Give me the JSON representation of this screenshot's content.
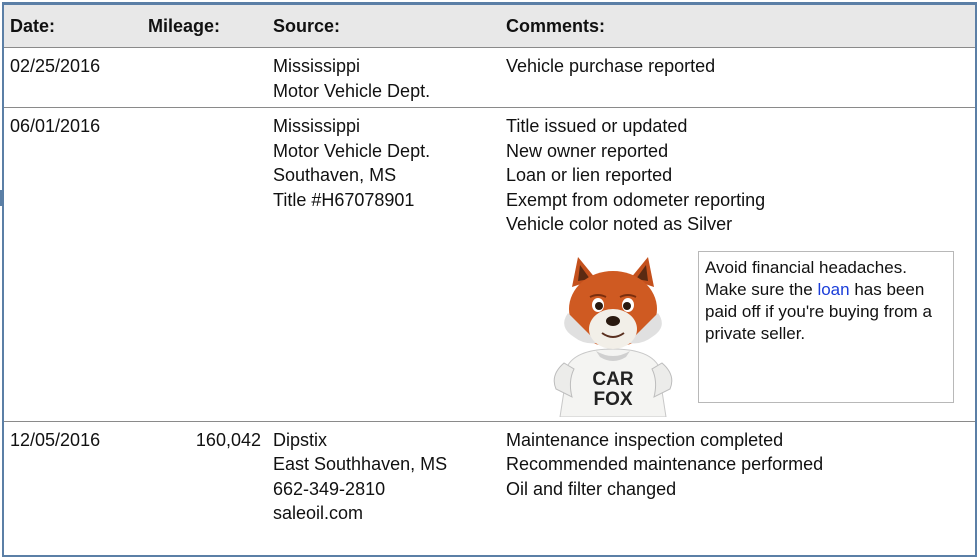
{
  "headers": {
    "date": "Date:",
    "mileage": "Mileage:",
    "source": "Source:",
    "comments": "Comments:"
  },
  "records": [
    {
      "date": "02/25/2016",
      "mileage": "",
      "source": [
        "Mississippi",
        "Motor Vehicle Dept."
      ],
      "comments": [
        "Vehicle purchase reported"
      ]
    },
    {
      "date": "06/01/2016",
      "mileage": "",
      "source": [
        "Mississippi",
        "Motor Vehicle Dept.",
        "Southaven, MS",
        "Title #H67078901"
      ],
      "comments": [
        "Title issued or updated",
        "New owner reported",
        "Loan or lien reported",
        "Exempt from odometer reporting",
        "Vehicle color noted as Silver"
      ]
    },
    {
      "date": "12/05/2016",
      "mileage": "160,042",
      "source": [
        "Dipstix",
        "East Southhaven, MS",
        "662-349-2810",
        "saleoil.com"
      ],
      "comments": [
        "Maintenance inspection completed",
        "Recommended maintenance performed",
        "Oil and filter changed"
      ]
    }
  ],
  "tip": {
    "before_link": "Avoid financial headaches. Make sure the ",
    "link_text": "loan",
    "after_link": " has been paid off if you're buying from a private seller."
  },
  "mascot": {
    "shirt_line1": "CAR",
    "shirt_line2": "FOX"
  },
  "colors": {
    "frame": "#5b7fa6",
    "header_bg": "#e8e8e8",
    "link": "#1a3dd9"
  }
}
